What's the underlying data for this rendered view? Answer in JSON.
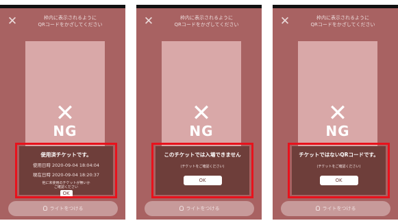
{
  "common": {
    "instruction": "枠内に表示されるように\nQRコードをかざしてください",
    "close_icon": "close-icon",
    "ng_mark": "✕",
    "ng_text": "NG",
    "light_button_label": "ライトをつける",
    "highlight_color": "#e8121c",
    "background_color": "#a86262"
  },
  "panels": [
    {
      "title": "使用済チケットです。",
      "used_label": "使用日時",
      "used_time": "2020-09-04 18:04:04",
      "current_label": "現在日時",
      "current_time": "2020-09-04 18:20:37",
      "note": "他に未使用のチケットが無いか\nご確認ください",
      "ok_label": "OK"
    },
    {
      "title": "このチケットでは入場できません",
      "note": "(チケットをご確認ください)",
      "ok_label": "OK"
    },
    {
      "title": "チケットではないQRコードです。",
      "note": "(チケットをご確認ください)",
      "ok_label": "OK"
    }
  ]
}
